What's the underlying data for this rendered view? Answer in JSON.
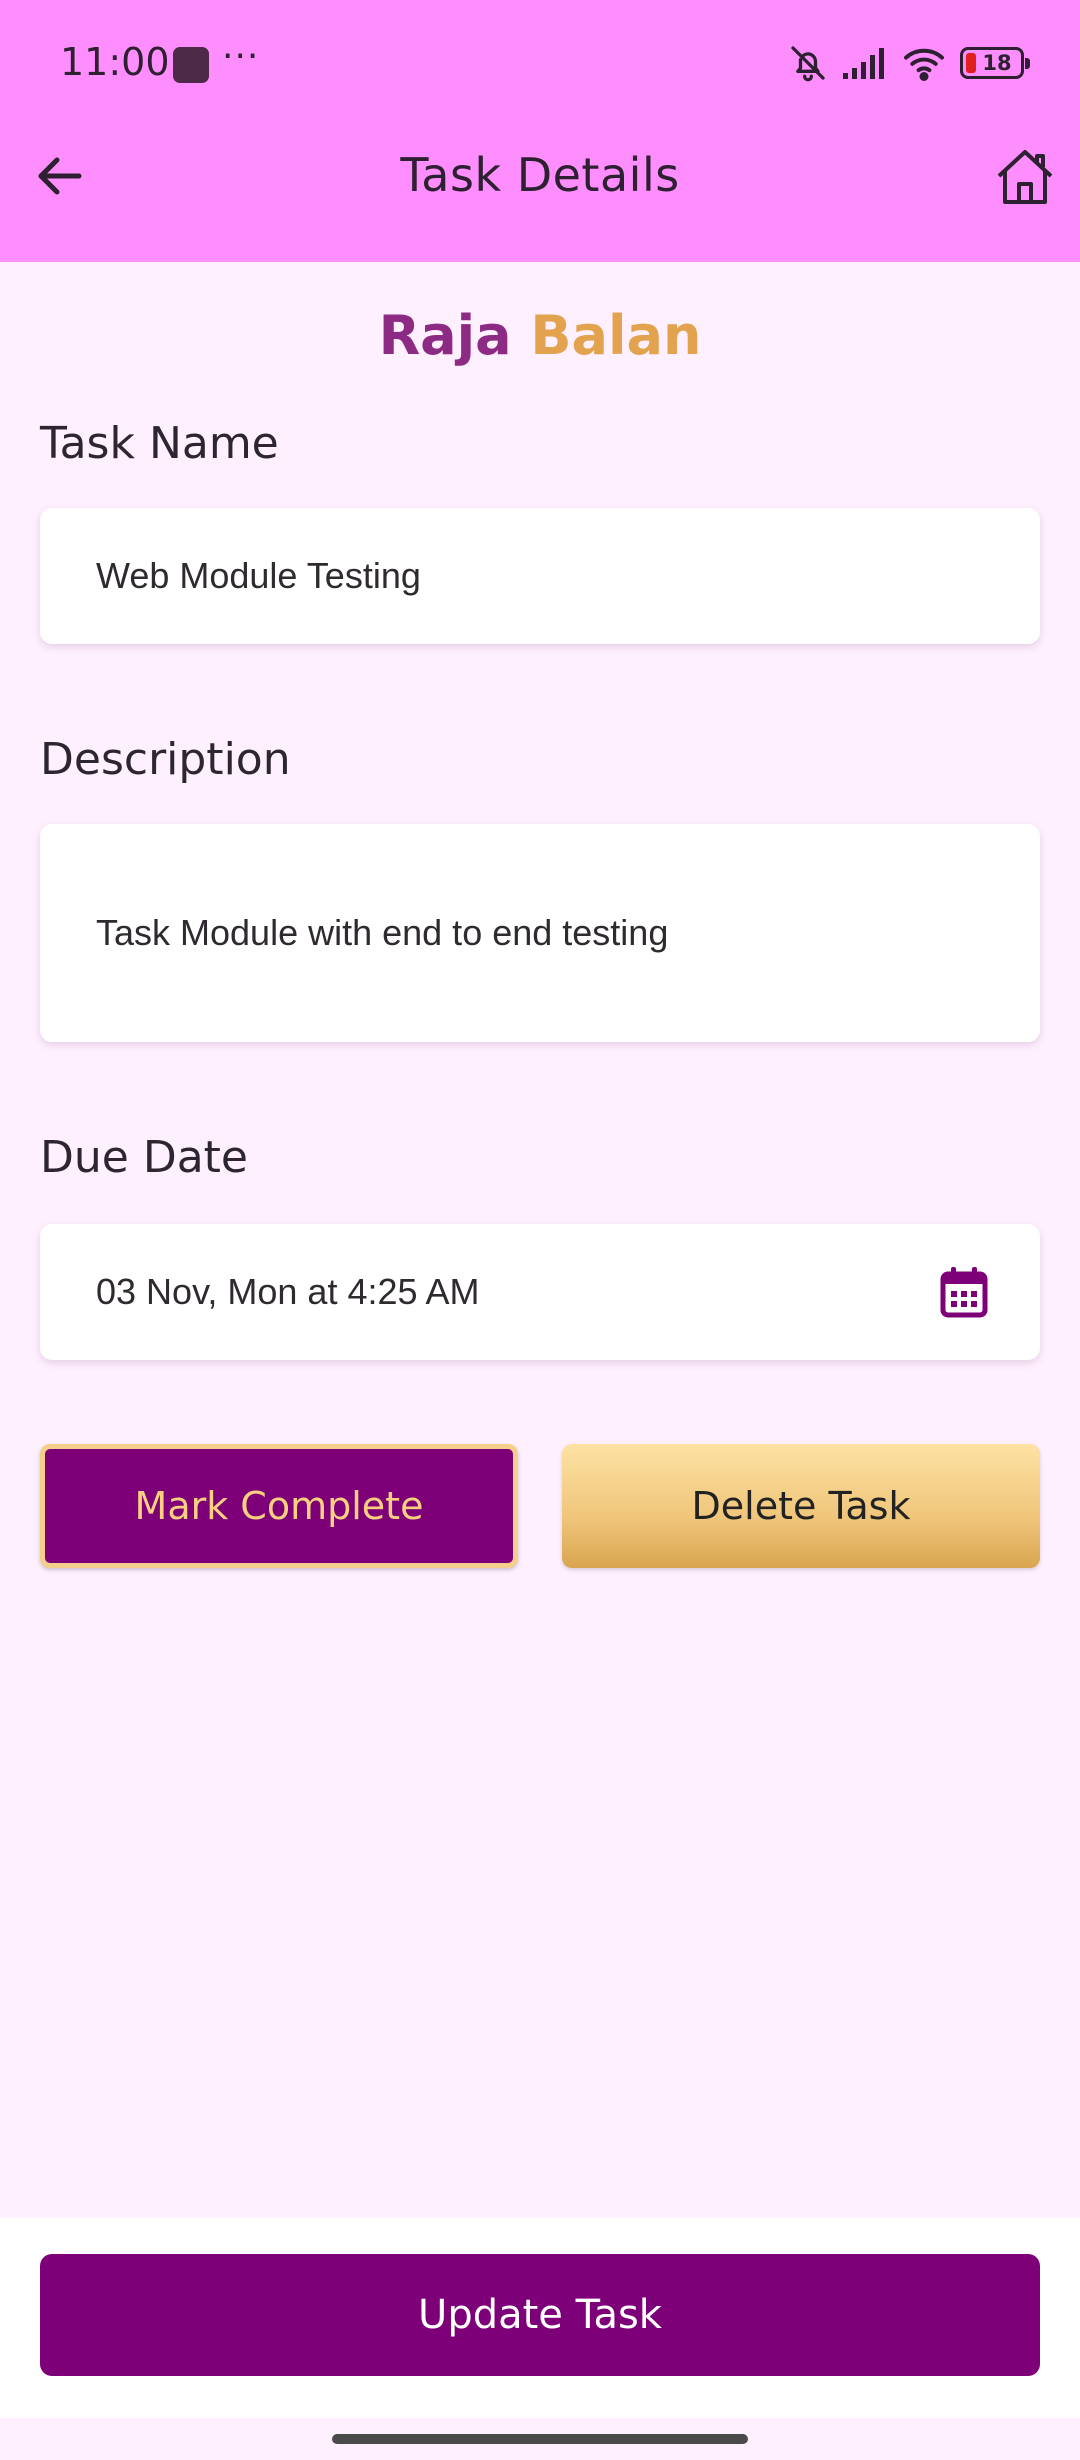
{
  "status_bar": {
    "time": "11:00",
    "battery": "18",
    "icons": [
      "app-icon",
      "more-dots-icon",
      "bell-off-icon",
      "signal-icon",
      "wifi-icon",
      "battery-icon"
    ]
  },
  "header": {
    "title": "Task Details",
    "back_icon": "arrow-left-icon",
    "home_icon": "home-icon",
    "background": "#fe8dfd"
  },
  "user": {
    "first_name": "Raja",
    "last_name": "Balan"
  },
  "form": {
    "task_name_label": "Task Name",
    "task_name_value": "Web Module Testing",
    "description_label": "Description",
    "description_value": "Task Module with end to end testing",
    "due_date_label": "Due Date",
    "due_date_value": "03 Nov, Mon at 4:25 AM",
    "calendar_icon": "calendar-icon"
  },
  "actions": {
    "mark_complete": "Mark Complete",
    "delete_task": "Delete Task",
    "update_task": "Update Task"
  },
  "colors": {
    "primary": "#7e0079",
    "accent_gold": "#efc57a",
    "page_bg": "#fef0fe"
  }
}
